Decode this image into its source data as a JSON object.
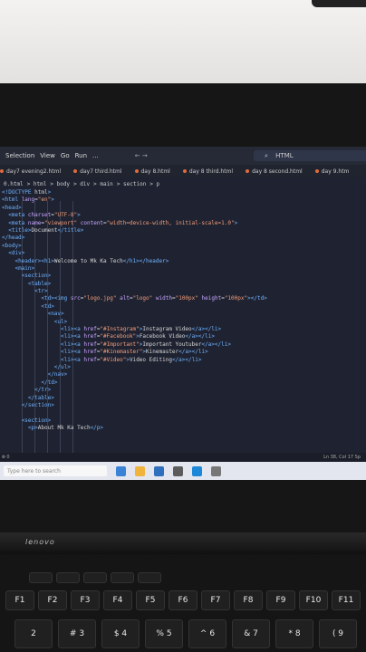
{
  "menu": [
    "Selection",
    "View",
    "Go",
    "Run",
    "..."
  ],
  "search_text": "HTML",
  "tabs": [
    {
      "label": "day7 evening2.html",
      "dot": "#e06b3c"
    },
    {
      "label": "day7 third.html",
      "dot": "#e06b3c"
    },
    {
      "label": "day 8.html",
      "dot": "#e06b3c"
    },
    {
      "label": "day 8 third.html",
      "dot": "#e06b3c"
    },
    {
      "label": "day 8 second.html",
      "dot": "#e06b3c"
    },
    {
      "label": "day 9.htm",
      "dot": "#e06b3c"
    }
  ],
  "breadcrumb": [
    "0.html",
    "html",
    "body",
    "div",
    "main",
    "section",
    "p"
  ],
  "code_lines": [
    "<!DOCTYPE html>",
    "<html lang=\"en\">",
    "<head>",
    "  <meta charset=\"UTF-8\">",
    "  <meta name=\"viewport\" content=\"width=device-width, initial-scale=1.0\">",
    "  <title>Document</title>",
    "</head>",
    "<body>",
    "  <div>",
    "    <header><h1>Welcome to Mk Ka Tech</h1></header>",
    "    <main>",
    "      <section>",
    "        <table>",
    "          <tr>",
    "            <td><img src=\"logo.jpg\" alt=\"logo\" width=\"100px\" height=\"100px\"></td>",
    "            <td>",
    "              <nav>",
    "                <ul>",
    "                  <li><a href=\"#Instagram\">Instagram Video</a></li>",
    "                  <li><a href=\"#Facebook\">Facebook Video</a></li>",
    "                  <li><a href=\"#Important\">Important Youtuber</a></li>",
    "                  <li><a href=\"#Kinemaster\">Kinemaster</a></li>",
    "                  <li><a href=\"#Video\">Video Editing</a></li>",
    "                </ul>",
    "              </nav>",
    "            </td>",
    "          </tr>",
    "        </table>",
    "      </section>",
    "",
    "      <section>",
    "        <p>About Mk Ka Tech</p>"
  ],
  "status_right": "Ln 38, Col 17  Sp",
  "taskbar_search": "Type here to search",
  "brand": "lenovo",
  "fn_keys": [
    "F1",
    "F2",
    "F3",
    "F4",
    "F5",
    "F6",
    "F7",
    "F8",
    "F9",
    "F10",
    "F11"
  ],
  "num_keys": [
    "2",
    "#\n3",
    "$\n4",
    "%\n5",
    "^\n6",
    "&\n7",
    "*\n8",
    "(\n9"
  ]
}
